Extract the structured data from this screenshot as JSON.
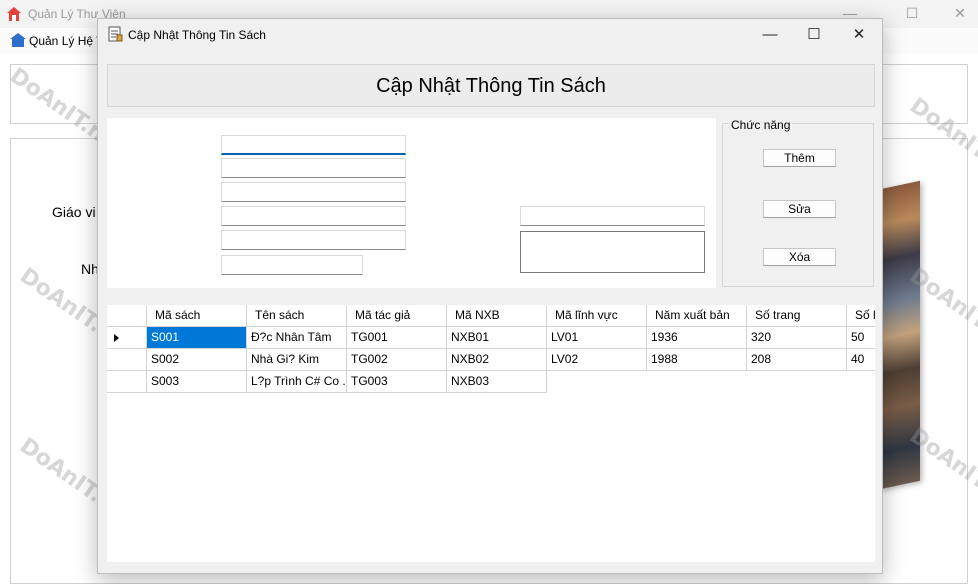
{
  "background_window": {
    "title": "Quản Lý Thư Viện",
    "menu_item": "Quản Lý Hệ T",
    "label_1": "Giáo vi",
    "label_2": "Nh",
    "controls": {
      "minimize": "—",
      "maximize": "☐",
      "close": "✕"
    }
  },
  "dialog": {
    "title": "Cập Nhật Thông Tin Sách",
    "header": "Cập Nhật Thông Tin Sách",
    "controls": {
      "minimize": "—",
      "maximize": "☐",
      "close": "✕"
    },
    "fields": [
      "",
      "",
      "",
      "",
      "",
      "",
      "",
      ""
    ],
    "actions": {
      "group_title": "Chức năng",
      "add": "Thêm",
      "edit": "Sửa",
      "delete": "Xóa"
    }
  },
  "grid": {
    "columns": [
      "Mã sách",
      "Tên sách",
      "Mã tác giả",
      "Mã NXB",
      "Mã lĩnh vực",
      "Năm xuất bản",
      "Số trang",
      "Số l"
    ],
    "rows": [
      [
        "S001",
        "Đ?c Nhân Tâm",
        "TG001",
        "NXB01",
        "LV01",
        "1936",
        "320",
        "50"
      ],
      [
        "S002",
        "Nhà Gi? Kim",
        "TG002",
        "NXB02",
        "LV02",
        "1988",
        "208",
        "40"
      ],
      [
        "S003",
        "L?p Trình C# Co ...",
        "TG003",
        "NXB03",
        "",
        "",
        "",
        ""
      ]
    ],
    "selected_row": 0,
    "selected_col": 0
  },
  "watermark": "DoAnIT.net",
  "colors": {
    "selection": "#0078d7",
    "focus_underline": "#0063b1"
  }
}
